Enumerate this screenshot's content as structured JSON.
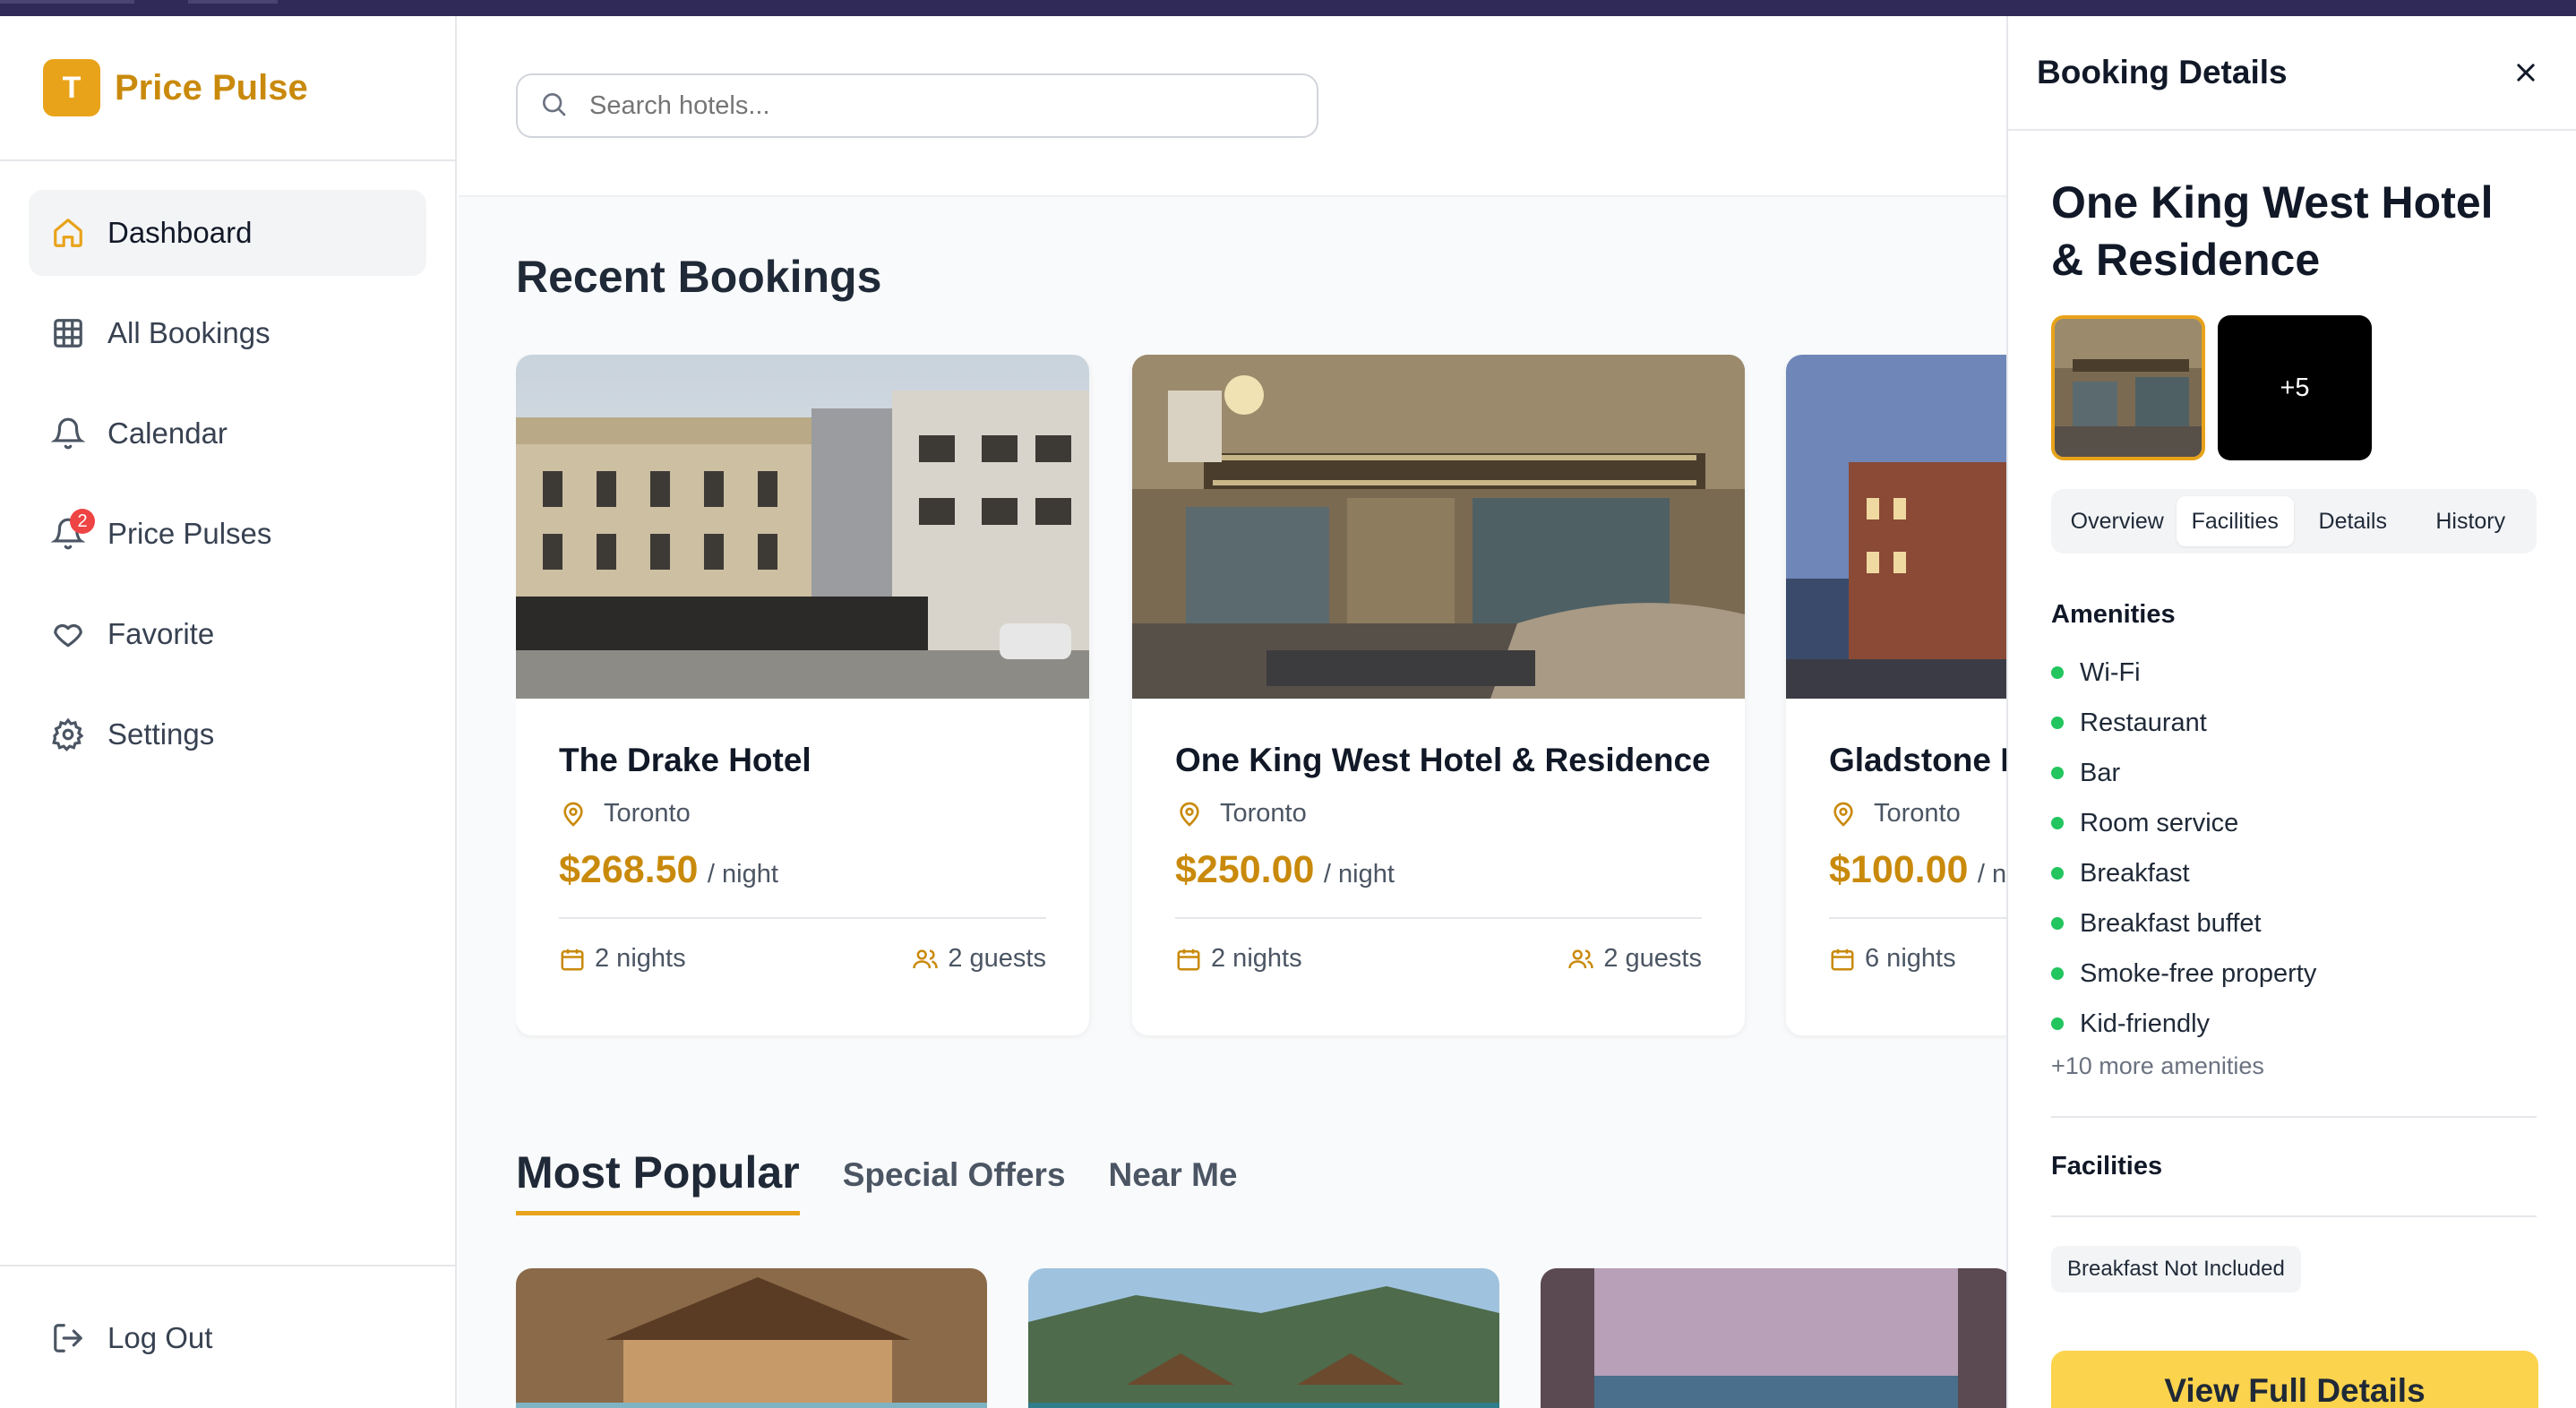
{
  "app": {
    "name": "Price Pulse",
    "logo_letter": "T"
  },
  "sidebar": {
    "items": [
      {
        "label": "Dashboard",
        "icon": "home-icon",
        "active": true
      },
      {
        "label": "All Bookings",
        "icon": "grid-icon"
      },
      {
        "label": "Calendar",
        "icon": "bell-icon"
      },
      {
        "label": "Price Pulses",
        "icon": "bell-alert-icon",
        "badge": "2"
      },
      {
        "label": "Favorite",
        "icon": "heart-icon"
      },
      {
        "label": "Settings",
        "icon": "gear-icon"
      }
    ],
    "logout_label": "Log Out"
  },
  "search": {
    "placeholder": "Search hotels..."
  },
  "recent": {
    "title": "Recent Bookings",
    "cards": [
      {
        "title": "The Drake Hotel",
        "location": "Toronto",
        "price": "$268.50",
        "unit": "/ night",
        "nights": "2 nights",
        "guests": "2 guests"
      },
      {
        "title": "One King West Hotel & Residence",
        "location": "Toronto",
        "price": "$250.00",
        "unit": "/ night",
        "nights": "2 nights",
        "guests": "2 guests"
      },
      {
        "title": "Gladstone Hotel",
        "location": "Toronto",
        "price": "$100.00",
        "unit": "/ night",
        "nights": "6 nights",
        "guests": ""
      }
    ]
  },
  "popular": {
    "tabs": [
      "Most Popular",
      "Special Offers",
      "Near Me"
    ]
  },
  "panel": {
    "title": "Booking Details",
    "hotel_name": "One King West Hotel & Residence",
    "more_photos": "+5",
    "tabs": [
      "Overview",
      "Facilities",
      "Details",
      "History"
    ],
    "active_tab": "Facilities",
    "amenities_title": "Amenities",
    "amenities": [
      "Wi-Fi",
      "Restaurant",
      "Bar",
      "Room service",
      "Breakfast",
      "Breakfast buffet",
      "Smoke-free property",
      "Kid-friendly"
    ],
    "more_amenities": "+10 more amenities",
    "facilities_title": "Facilities",
    "chip": "Breakfast Not Included",
    "cta": "View Full Details"
  },
  "colors": {
    "brand": "#e8a31a",
    "price": "#c98a0c",
    "cta": "#fcd34d",
    "amenity_dot": "#22c55e",
    "topbar": "#2f2a57"
  }
}
